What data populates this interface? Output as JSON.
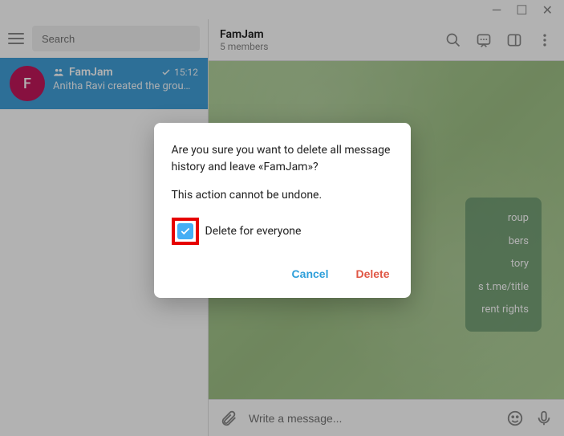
{
  "window": {
    "min": "—",
    "max": "☐",
    "close": "✕"
  },
  "sidebar": {
    "search_placeholder": "Search",
    "chat": {
      "avatar": "F",
      "name": "FamJam",
      "time": "15:12",
      "preview": "Anitha Ravi created the grou…"
    }
  },
  "header": {
    "title": "FamJam",
    "subtitle": "5 members"
  },
  "menu": {
    "items": [
      "roup",
      "bers",
      "tory",
      "s t.me/title",
      "rent rights"
    ]
  },
  "composer": {
    "placeholder": "Write a message..."
  },
  "dialog": {
    "text": "Are you sure you want to delete all message history and leave «FamJam»?",
    "warning": "This action cannot be undone.",
    "checkbox_label": "Delete for everyone",
    "cancel": "Cancel",
    "delete": "Delete"
  }
}
